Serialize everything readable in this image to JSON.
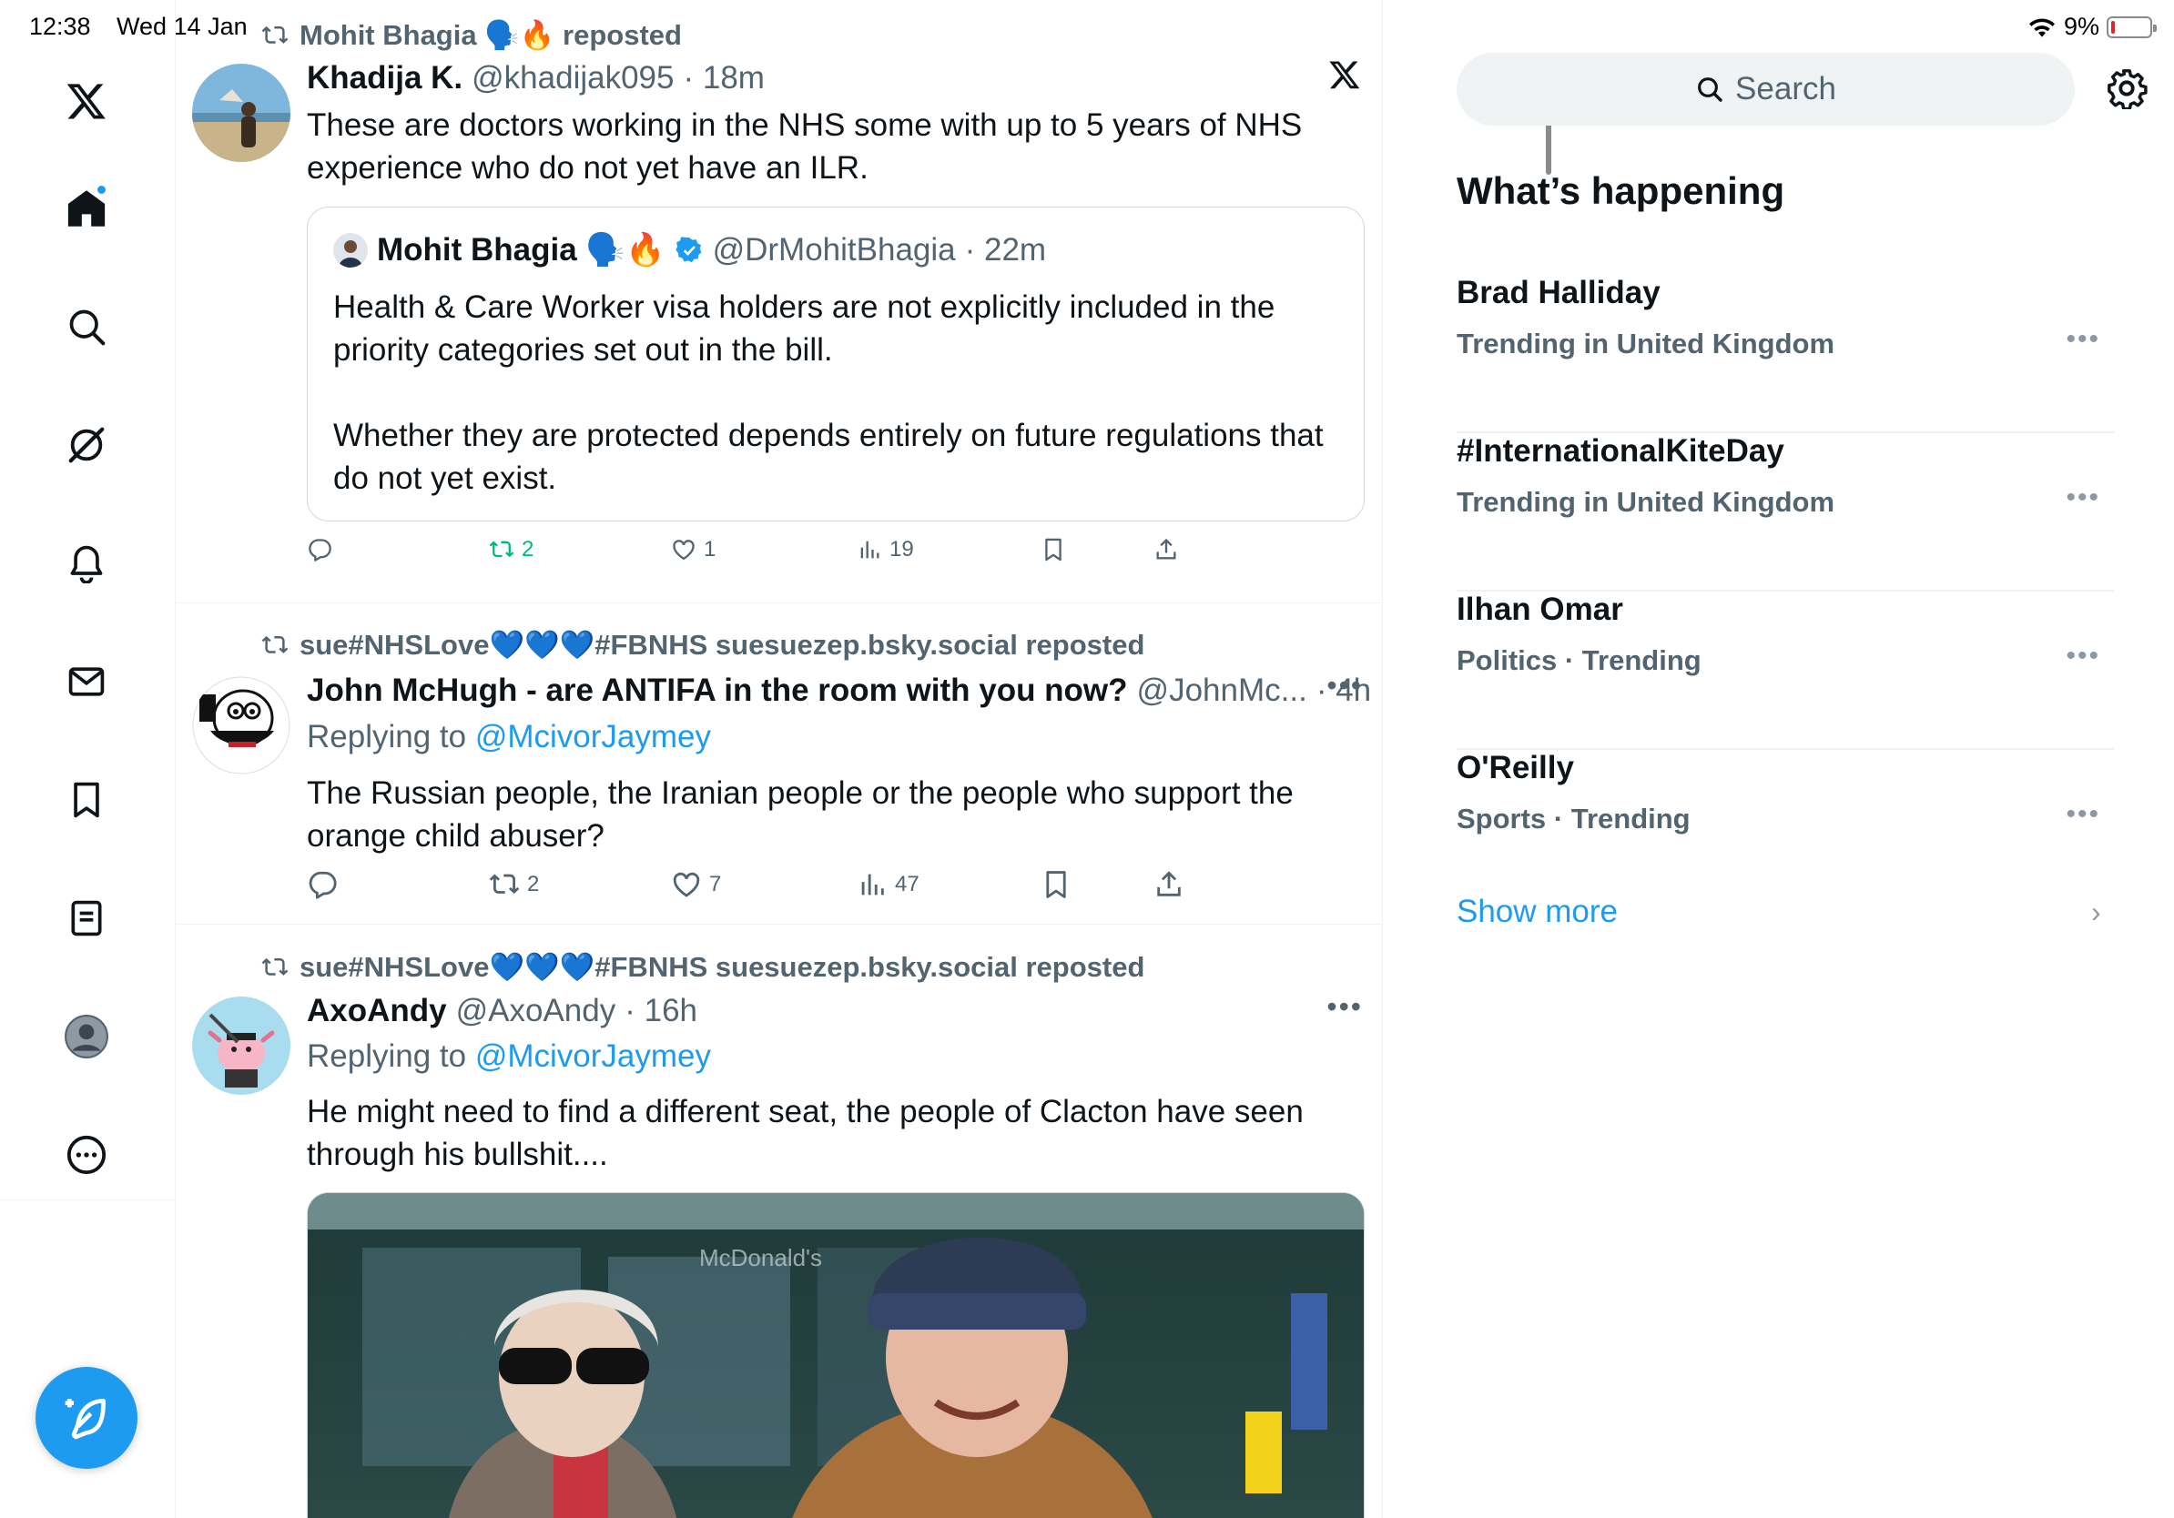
{
  "status_bar": {
    "time": "12:38",
    "date": "Wed 14 Jan",
    "battery": "9%",
    "battery_level": 0.09
  },
  "nav": {
    "items": [
      "x-logo",
      "home",
      "explore",
      "grok",
      "notifications",
      "messages",
      "bookmarks",
      "lists",
      "profile",
      "more"
    ]
  },
  "tweets": [
    {
      "repost_label": "Mohit Bhagia 🗣️🔥 reposted",
      "author_name": "Khadija K.",
      "handle": "@khadijak095",
      "time": "· 18m",
      "text": "These are doctors working in the NHS some with up to 5 years of NHS experience who do not yet have an ILR.",
      "quote": {
        "author_name": "Mohit Bhagia 🗣️🔥",
        "handle": "@DrMohitBhagia",
        "time": "· 22m",
        "text_1": "Health & Care Worker visa holders are not explicitly included in the priority categories set out in the bill.",
        "text_2": "Whether they are protected depends entirely on future regulations that do not yet exist."
      },
      "stats": {
        "retweets": "2",
        "likes": "1",
        "views": "19"
      }
    },
    {
      "repost_label": "sue#NHSLove💙💙💙#FBNHS suesuezep.bsky.social reposted",
      "author_name": "John McHugh - are ANTIFA in the room with you now?",
      "handle": "@JohnMc...",
      "time": "· 4h",
      "replying_prefix": "Replying to ",
      "replying_handle": "@McivorJaymey",
      "text": "The Russian people, the Iranian people or the people who support the orange child abuser?",
      "stats": {
        "retweets": "2",
        "likes": "7",
        "views": "47"
      }
    },
    {
      "repost_label": "sue#NHSLove💙💙💙#FBNHS suesuezep.bsky.social reposted",
      "author_name": "AxoAndy",
      "handle": "@AxoAndy",
      "time": "· 16h",
      "replying_prefix": "Replying to ",
      "replying_handle": "@McivorJaymey",
      "text": "He might need to find a different seat, the people of Clacton have seen through his bullshit....",
      "media_sign": "McDonald's"
    }
  ],
  "right": {
    "search_placeholder": "Search",
    "section_title": "What’s happening",
    "trends": [
      {
        "name": "Brad Halliday",
        "meta": "Trending in United Kingdom"
      },
      {
        "name": "#InternationalKiteDay",
        "meta": "Trending in United Kingdom"
      },
      {
        "name": "Ilhan Omar",
        "meta": "Politics · Trending"
      },
      {
        "name": "O'Reilly",
        "meta": "Sports · Trending"
      }
    ],
    "show_more": "Show more"
  },
  "colors": {
    "accent": "#1d9bf0",
    "text": "#0f1419",
    "muted": "#536471",
    "retweet_active": "#00ba7c"
  }
}
